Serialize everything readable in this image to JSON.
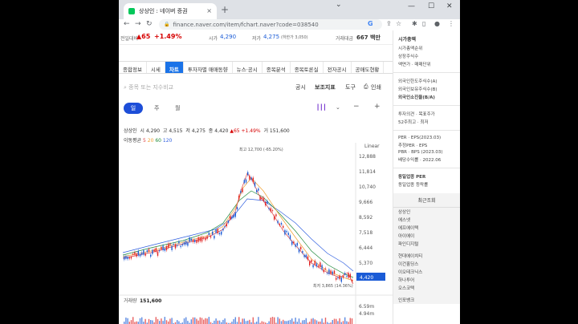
{
  "browser": {
    "tab_title": "상상인 : 네이버 증권",
    "tab_close": "×",
    "new_tab": "+",
    "url": "finance.naver.com/item/fchart.naver?code=038540",
    "win_min": "—",
    "win_max": "☐",
    "win_close": "✕"
  },
  "quote": {
    "prev_label": "전일대비",
    "change": "▲65",
    "change_pct": "+1.49%",
    "open_label": "시가",
    "open_value": "4,290",
    "low_label": "저가",
    "low_value": "4,275",
    "low_limit": "(하한가 3,050)",
    "volume_label": "거래대금",
    "volume_value": "667 백만"
  },
  "nav": {
    "items": [
      "종합정보",
      "시세",
      "차트",
      "투자자별 매매동향",
      "뉴스·공시",
      "종목분석",
      "종목토론실",
      "전자공시",
      "공매도현황"
    ],
    "active": "차트"
  },
  "toolbar": {
    "search_placeholder": "종목 또는 지수비교",
    "announce": "공시",
    "indicator": "보조지표",
    "tools": "도구",
    "print": "인쇄"
  },
  "period": {
    "day": "일",
    "week": "주",
    "month": "월"
  },
  "ohlc": {
    "name": "상상인",
    "open_label": "시",
    "open": "4,290",
    "high_label": "고",
    "high": "4,515",
    "low_label": "저",
    "low": "4,275",
    "close_label": "종",
    "close": "4,420",
    "change": "▲65 +1.49%",
    "vol_label": "거",
    "vol": "151,600"
  },
  "moving_avg": {
    "label": "이동평균",
    "p5": "5",
    "p20": "20",
    "p60": "60",
    "p120": "120"
  },
  "chart": {
    "scale_label": "Linear",
    "y_ticks": [
      "12,888",
      "11,814",
      "10,740",
      "9,666",
      "8,592",
      "7,518",
      "6,444",
      "5,370"
    ],
    "current_price": "4,420",
    "high_annotation": "최고 12,700 (-65.20%)",
    "low_annotation": "최저 3,865 (14.36%)",
    "volume_label": "거래량",
    "volume_value": "151,600",
    "volume_ticks": [
      "6.59m",
      "4.94m"
    ],
    "colors": {
      "up": "#e02020",
      "down": "#1a5bd6",
      "ma5": "#e04444",
      "ma20": "#f0a030",
      "ma60": "#1e8a3a",
      "ma120": "#3060e0"
    }
  },
  "sidebar": {
    "section1": [
      "시가총액",
      "시가총액순위",
      "상장주식수",
      "액면가 · 매매단위"
    ],
    "section2": [
      "외국인한도주식수(A)",
      "외국인보유주식수(B)",
      "외국인소진율(B/A)"
    ],
    "section3": [
      "투자의견 · 목표주가",
      "52주최고 · 최저"
    ],
    "section4": [
      "PER · EPS(2023.03)",
      "추정PER · EPS",
      "PBR · BPS (2023.03)",
      "배당수익률 · 2022.06"
    ],
    "section5": [
      "동일업종 PER",
      "동일업종 등락률"
    ],
    "recent_title": "최근조회",
    "recent": [
      "상상인",
      "에스넷",
      "에프에이텍",
      "아이에이",
      "파인디지털",
      "",
      "현대에이치티",
      "이건홀딩스",
      "이오테크닉스",
      "하나투어",
      "오스코텍",
      "",
      "인포뱅크"
    ]
  }
}
